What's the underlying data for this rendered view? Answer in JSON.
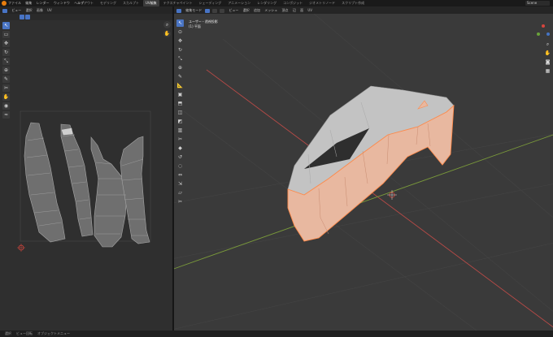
{
  "app": {
    "scene_name": "Scene"
  },
  "menu": [
    "ファイル",
    "編集",
    "レンダー",
    "ウィンドウ",
    "ヘルプ"
  ],
  "workspace_tabs": [
    {
      "label": "レイアウト"
    },
    {
      "label": "モデリング"
    },
    {
      "label": "スカルプト"
    },
    {
      "label": "UV編集",
      "active": true
    },
    {
      "label": "テクスチャペイント"
    },
    {
      "label": "シェーディング"
    },
    {
      "label": "アニメーション"
    },
    {
      "label": "レンダリング"
    },
    {
      "label": "コンポジット"
    },
    {
      "label": "ジオメトリノード"
    },
    {
      "label": "スクリプト作成"
    }
  ],
  "uv_editor": {
    "header_menus": [
      "ビュー",
      "選択",
      "画像",
      "UV"
    ],
    "tools": [
      "cursor-select",
      "select-box",
      "grab",
      "rotate",
      "scale",
      "transform",
      "annotate",
      "rip",
      "grab-brush",
      "pinch",
      "relax"
    ],
    "nav_icons": [
      "zoom-icon",
      "hand-icon"
    ],
    "colors": {
      "island_fill": "#6f6f6f",
      "island_edge": "#a7a7a7",
      "selected_face": "#cfcfcf",
      "bounds": "#4a4a4a",
      "cursor": "#d6463d"
    }
  },
  "viewport": {
    "mode": "編集モード",
    "header_menus": [
      "ビュー",
      "選択",
      "追加",
      "メッシュ",
      "頂点",
      "辺",
      "面",
      "UV"
    ],
    "overlay_line1": "ユーザー・透視投影",
    "overlay_line2": "(1) 平面",
    "tools": [
      "cursor-select",
      "cursor",
      "move",
      "rotate",
      "scale",
      "transform",
      "annotate",
      "measure",
      "add-cube",
      "extrude",
      "inset",
      "bevel",
      "loop-cut",
      "knife",
      "poly-build",
      "spin",
      "smooth",
      "edge-slide",
      "shrink",
      "shear",
      "rip"
    ],
    "nav_icons": [
      "zoom-icon",
      "hand-icon",
      "camera-icon",
      "grid-icon"
    ],
    "colors": {
      "background": "#3a3a3a",
      "grid": "#444444",
      "x_axis": "#b84a47",
      "y_axis": "#7a9a3a",
      "mesh_unselected": "#c3c3c3",
      "mesh_selected": "#e8b8a0",
      "selected_edge": "#ff8a4a",
      "cursor": "#d6463d"
    }
  },
  "statusbar": {
    "items": [
      "選択",
      "ビュー回転",
      "オブジェクトメニュー"
    ]
  }
}
